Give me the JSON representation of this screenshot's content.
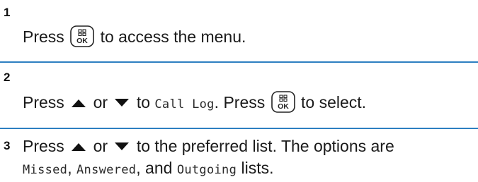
{
  "steps": [
    {
      "number": "1",
      "parts": [
        "Press",
        "to access the menu."
      ]
    },
    {
      "number": "2",
      "parts": [
        "Press",
        "or",
        "to",
        "Call Log",
        ". Press",
        "to select."
      ]
    },
    {
      "number": "3",
      "line1": [
        "Press",
        "or",
        "to the preferred list. The options are"
      ],
      "line2": [
        "Missed",
        ", ",
        "Answered",
        ", and ",
        "Outgoing",
        " lists."
      ]
    }
  ],
  "icons": {
    "ok_key": "menu-ok-key-icon",
    "up": "up-arrow-icon",
    "down": "down-arrow-icon"
  },
  "colors": {
    "divider": "#2d7fc1",
    "text": "#1a1a1a"
  }
}
